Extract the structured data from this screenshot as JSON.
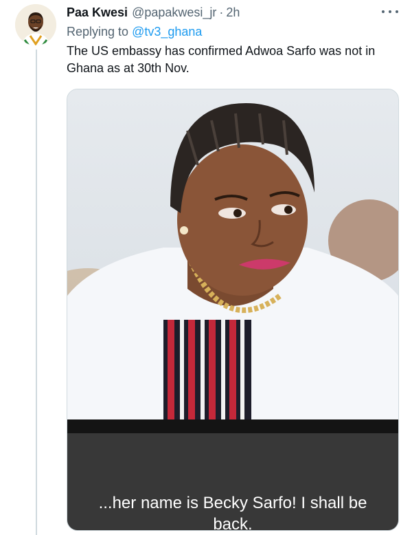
{
  "tweet": {
    "author_name": "Paa Kwesi",
    "author_handle": "@papakwesi_jr",
    "separator": "·",
    "timestamp": "2h",
    "replying_prefix": "Replying to",
    "replying_to": "@tv3_ghana",
    "text": "The US embassy has confirmed Adwoa Sarfo was not in Ghana as at 30th Nov."
  },
  "media": {
    "caption": "...her name is Becky Sarfo! I shall be back."
  },
  "icons": {
    "more": "more-horizontal-icon"
  },
  "colors": {
    "link": "#1d9bf0",
    "secondary_text": "#536471",
    "thread_line": "#cfd9de"
  }
}
